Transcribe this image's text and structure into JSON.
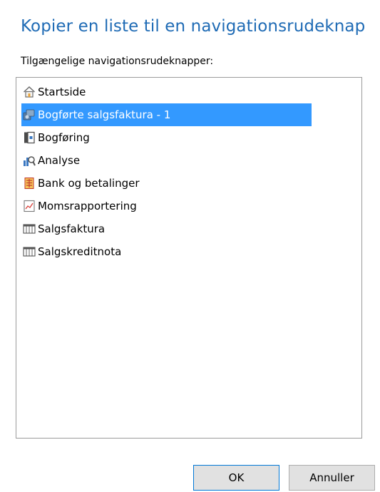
{
  "dialog": {
    "title": "Kopier en liste til en navigationsrudeknap",
    "list_label": "Tilgængelige navigationsrudeknapper:"
  },
  "list": {
    "selected_index": 1,
    "items": [
      {
        "label": "Startside",
        "icon": "home-icon"
      },
      {
        "label": "Bogførte salgsfaktura - 1",
        "icon": "posted-documents-icon"
      },
      {
        "label": "Bogføring",
        "icon": "posting-icon"
      },
      {
        "label": "Analyse",
        "icon": "analysis-icon"
      },
      {
        "label": "Bank og betalinger",
        "icon": "bank-icon"
      },
      {
        "label": "Momsrapportering",
        "icon": "report-chart-icon"
      },
      {
        "label": "Salgsfaktura",
        "icon": "list-page-icon"
      },
      {
        "label": "Salgskreditnota",
        "icon": "list-page-icon"
      }
    ]
  },
  "buttons": {
    "ok_label": "OK",
    "cancel_label": "Annuller"
  },
  "colors": {
    "title": "#1f6bb5",
    "selection": "#3399ff",
    "button_face": "#e1e1e1",
    "default_button_border": "#0078d7"
  }
}
